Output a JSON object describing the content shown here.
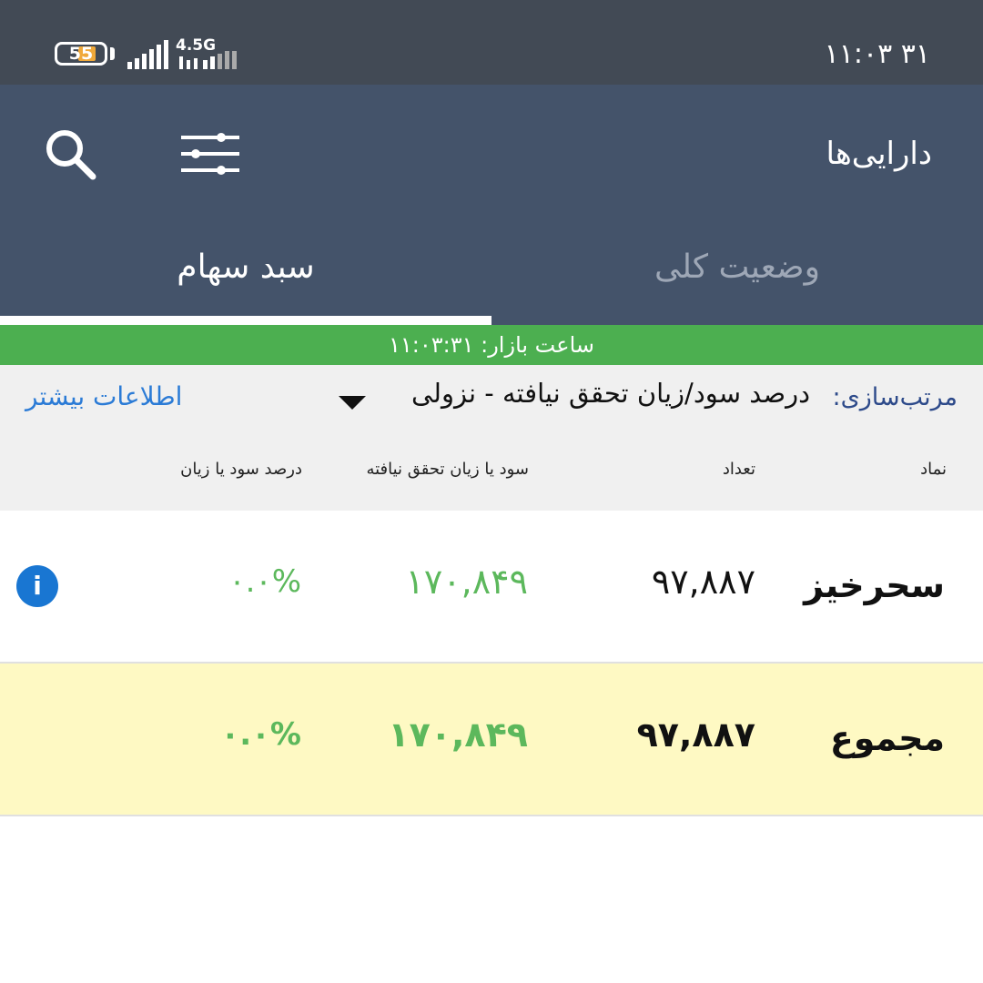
{
  "status_bar": {
    "battery_level": "55",
    "network_type": "4.5G",
    "time": "۳۱  ۱۱:۰۳"
  },
  "app_bar": {
    "title": "دارایی‌ها",
    "icons": [
      "search-icon",
      "filter-icon"
    ]
  },
  "tabs": [
    {
      "label": "وضعیت کلی",
      "active": false
    },
    {
      "label": "سبد سهام",
      "active": true
    }
  ],
  "market": {
    "text": "ساعت بازار: ۱۱:۰۳:۳۱"
  },
  "sort": {
    "label": "مرتب‌سازی:",
    "value": "درصد سود/زیان تحقق نیافته - نزولی",
    "more_link": "اطلاعات بیشتر"
  },
  "table": {
    "headers": {
      "symbol": "نماد",
      "count": "تعداد",
      "profit": "سود یا زیان تحقق نیافته",
      "percent": "درصد سود یا زیان"
    },
    "rows": [
      {
        "symbol": "سحرخیز",
        "count": "۹۷,۸۸۷",
        "profit": "۱۷۰,۸۴۹",
        "percent": "۰.۰%"
      }
    ],
    "total": {
      "symbol": "مجموع",
      "count": "۹۷,۸۸۷",
      "profit": "۱۷۰,۸۴۹",
      "percent": "۰.۰%"
    }
  },
  "colors": {
    "status_bar": "#424a55",
    "app_bar": "#44536a",
    "market_bar": "#4caf50",
    "positive": "#5cb85c",
    "total_row": "#fef9c3",
    "link": "#2b7bd6"
  }
}
